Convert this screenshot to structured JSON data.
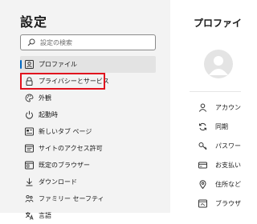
{
  "sidebar": {
    "title": "設定",
    "search": {
      "placeholder": "設定の検索",
      "icon": "search-icon"
    },
    "items": [
      {
        "label": "プロファイル",
        "icon": "profile-icon",
        "selected": true
      },
      {
        "label": "プライバシーとサービス",
        "icon": "lock-icon",
        "selected": false,
        "highlighted": true
      },
      {
        "label": "外観",
        "icon": "palette-icon",
        "selected": false
      },
      {
        "label": "起動時",
        "icon": "power-icon",
        "selected": false
      },
      {
        "label": "新しいタブ ページ",
        "icon": "new-tab-icon",
        "selected": false
      },
      {
        "label": "サイトのアクセス許可",
        "icon": "site-permissions-icon",
        "selected": false
      },
      {
        "label": "既定のブラウザー",
        "icon": "default-browser-icon",
        "selected": false
      },
      {
        "label": "ダウンロード",
        "icon": "download-icon",
        "selected": false
      },
      {
        "label": "ファミリー セーフティ",
        "icon": "family-icon",
        "selected": false
      },
      {
        "label": "言語",
        "icon": "language-icon",
        "selected": false
      }
    ]
  },
  "main": {
    "title": "プロファイル",
    "items": [
      {
        "label": "アカウン",
        "icon": "person-icon"
      },
      {
        "label": "同期",
        "icon": "sync-icon"
      },
      {
        "label": "パスワー",
        "icon": "key-icon"
      },
      {
        "label": "お支払い",
        "icon": "payment-icon"
      },
      {
        "label": "住所など",
        "icon": "location-icon"
      },
      {
        "label": "ブラウザ",
        "icon": "browser-data-icon"
      }
    ]
  },
  "colors": {
    "accent": "#0067c0",
    "highlight_box": "#e1131e",
    "sidebar_bg": "#f3f3f3",
    "selected_bg": "#e3e3e3"
  }
}
